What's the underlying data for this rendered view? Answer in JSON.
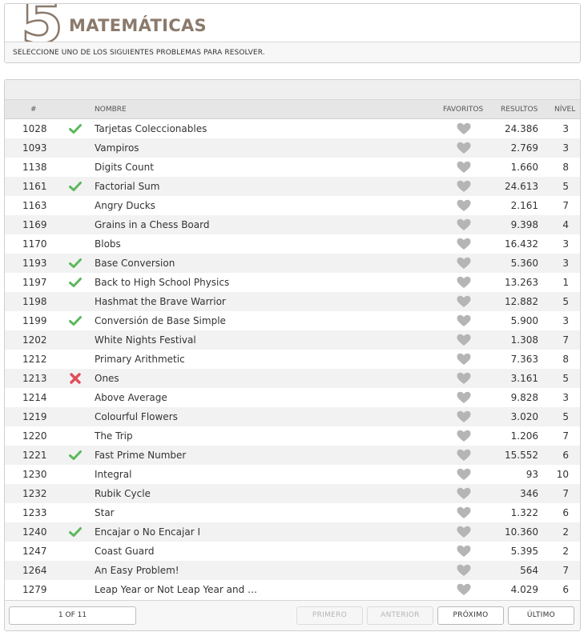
{
  "header": {
    "category_number": "5",
    "title": "MATEMÁTICAS",
    "subtitle": "SELECCIONE UNO DE LOS SIGUIENTES PROBLEMAS PARA RESOLVER."
  },
  "table": {
    "columns": {
      "num": "#",
      "name": "NOMBRE",
      "favorites": "FAVORITOS",
      "results": "RESULTOS",
      "level": "NÍVEL"
    },
    "rows": [
      {
        "num": "1028",
        "status": "solved",
        "name": "Tarjetas Coleccionables",
        "results": "24.386",
        "level": "3"
      },
      {
        "num": "1093",
        "status": "none",
        "name": "Vampiros",
        "results": "2.769",
        "level": "3"
      },
      {
        "num": "1138",
        "status": "none",
        "name": "Digits Count",
        "results": "1.660",
        "level": "8"
      },
      {
        "num": "1161",
        "status": "solved",
        "name": "Factorial Sum",
        "results": "24.613",
        "level": "5"
      },
      {
        "num": "1163",
        "status": "none",
        "name": "Angry Ducks",
        "results": "2.161",
        "level": "7"
      },
      {
        "num": "1169",
        "status": "none",
        "name": "Grains in a Chess Board",
        "results": "9.398",
        "level": "4"
      },
      {
        "num": "1170",
        "status": "none",
        "name": "Blobs",
        "results": "16.432",
        "level": "3"
      },
      {
        "num": "1193",
        "status": "solved",
        "name": "Base Conversion",
        "results": "5.360",
        "level": "3"
      },
      {
        "num": "1197",
        "status": "solved",
        "name": "Back to High School Physics",
        "results": "13.263",
        "level": "1"
      },
      {
        "num": "1198",
        "status": "none",
        "name": "Hashmat the Brave Warrior",
        "results": "12.882",
        "level": "5"
      },
      {
        "num": "1199",
        "status": "solved",
        "name": "Conversión de Base Simple",
        "results": "5.900",
        "level": "3"
      },
      {
        "num": "1202",
        "status": "none",
        "name": "White Nights Festival",
        "results": "1.308",
        "level": "7"
      },
      {
        "num": "1212",
        "status": "none",
        "name": "Primary Arithmetic",
        "results": "7.363",
        "level": "8"
      },
      {
        "num": "1213",
        "status": "failed",
        "name": "Ones",
        "results": "3.161",
        "level": "5"
      },
      {
        "num": "1214",
        "status": "none",
        "name": "Above Average",
        "results": "9.828",
        "level": "3"
      },
      {
        "num": "1219",
        "status": "none",
        "name": "Colourful Flowers",
        "results": "3.020",
        "level": "5"
      },
      {
        "num": "1220",
        "status": "none",
        "name": "The Trip",
        "results": "1.206",
        "level": "7"
      },
      {
        "num": "1221",
        "status": "solved",
        "name": "Fast Prime Number",
        "results": "15.552",
        "level": "6"
      },
      {
        "num": "1230",
        "status": "none",
        "name": "Integral",
        "results": "93",
        "level": "10"
      },
      {
        "num": "1232",
        "status": "none",
        "name": "Rubik Cycle",
        "results": "346",
        "level": "7"
      },
      {
        "num": "1233",
        "status": "none",
        "name": "Star",
        "results": "1.322",
        "level": "6"
      },
      {
        "num": "1240",
        "status": "solved",
        "name": "Encajar o No Encajar I",
        "results": "10.360",
        "level": "2"
      },
      {
        "num": "1247",
        "status": "none",
        "name": "Coast Guard",
        "results": "5.395",
        "level": "2"
      },
      {
        "num": "1264",
        "status": "none",
        "name": "An Easy Problem!",
        "results": "564",
        "level": "7"
      },
      {
        "num": "1279",
        "status": "none",
        "name": "Leap Year or Not Leap Year and …",
        "results": "4.029",
        "level": "6"
      }
    ]
  },
  "pagination": {
    "page_info": "1 OF 11",
    "first": "PRIMERO",
    "previous": "ANTERIOR",
    "next": "PRÓXIMO",
    "last": "ÚLTIMO"
  },
  "icons": {
    "solved": "check-icon",
    "failed": "cross-icon",
    "favorite": "heart-icon"
  },
  "colors": {
    "title": "#8b7a6c",
    "solved": "#5cb85c",
    "failed": "#e14b57",
    "heart": "#b5b5b5"
  }
}
